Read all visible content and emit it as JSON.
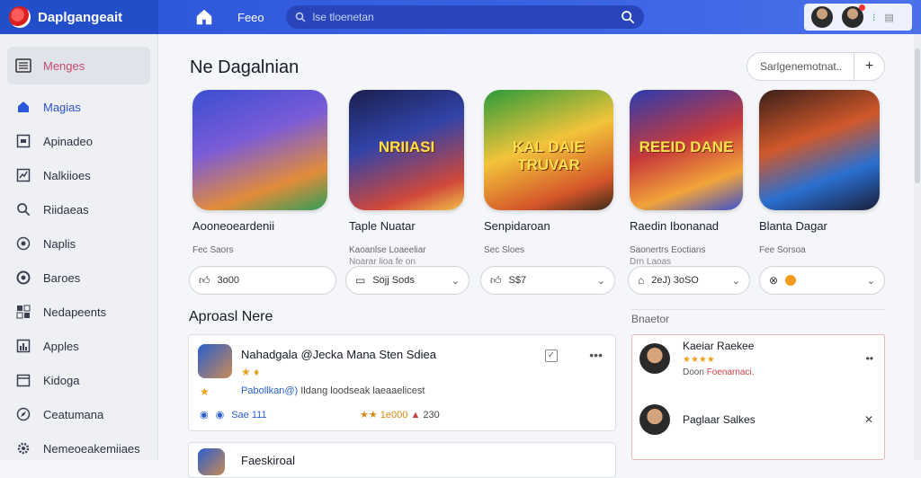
{
  "app": {
    "name": "Daplgangeait"
  },
  "header": {
    "nav_label": "Feeo",
    "search_placeholder": "lse tloenetan"
  },
  "sidebar": {
    "head": "Menges",
    "items": [
      {
        "label": "Magias",
        "icon": "home-icon",
        "active": true
      },
      {
        "label": "Apinadeo",
        "icon": "square-icon"
      },
      {
        "label": "Nalkiioes",
        "icon": "chart-icon"
      },
      {
        "label": "Riidaeas",
        "icon": "search-icon"
      },
      {
        "label": "Naplis",
        "icon": "chat-icon"
      },
      {
        "label": "Baroes",
        "icon": "circle-icon"
      },
      {
        "label": "Nedapeents",
        "icon": "grid-icon"
      },
      {
        "label": "Apples",
        "icon": "bar-chart-icon"
      },
      {
        "label": "Kidoga",
        "icon": "calendar-icon"
      },
      {
        "label": "Ceatumana",
        "icon": "compass-icon"
      },
      {
        "label": "Nemeoeakemiiaes",
        "icon": "gear-icon"
      }
    ]
  },
  "main": {
    "title": "Ne Dagalnian",
    "search_label": "Sarlgenemotnat..",
    "add_label": "+",
    "cards": [
      {
        "title": "Aooneoeardenii",
        "sub1": "Fec Saors",
        "sub2": "",
        "art": "",
        "rating": "3o00",
        "rating_icon": "thumbs-up-icon"
      },
      {
        "title": "Taple Nuatar",
        "sub1": "Kaoanlse Loaeeliar",
        "sub2": "Noarar lioa fe on",
        "art": "NRIIASI",
        "rating": "Sojj Sods",
        "rating_icon": "box-icon"
      },
      {
        "title": "Senpidaroan",
        "sub1": "Sec Sloes",
        "sub2": "",
        "art": "KAL DAIE TRUVAR",
        "rating": "S$7",
        "rating_icon": "thumbs-up-icon"
      },
      {
        "title": "Raedin Ibonanad",
        "sub1": "Saonertrs Eoctians",
        "sub2": "Drn Laoas",
        "art": "REEID DANE",
        "rating": "2eJ) 3oSO",
        "rating_icon": "bag-icon"
      },
      {
        "title": "Blanta Dagar",
        "sub1": "Fee Sorsoa",
        "sub2": "",
        "art": "",
        "rating": "",
        "rating_icon": "share-icon"
      }
    ],
    "feed_title": "Aproasl Nere",
    "post": {
      "title": "Nahadgala @Jecka Mana Sten Sdiea",
      "body_hl": "Pabollkan@)",
      "body": "Ildang loodseak laeaaelicest",
      "likes": "Sae 111",
      "stats_gold": "1e000",
      "stats": "230"
    },
    "post2": {
      "title": "Faeskiroal"
    },
    "side_label": "Bnaetor",
    "side_items": [
      {
        "name": "Kaeiar Raekee",
        "sub": "Doon",
        "sub_red": "Foenarnaci.",
        "action": "••"
      },
      {
        "name": "Paglaar Salkes",
        "sub": "",
        "sub_red": "",
        "action": "✕"
      }
    ]
  },
  "colors": {
    "brand": "#2b53d6",
    "accent_red": "#c94040"
  }
}
